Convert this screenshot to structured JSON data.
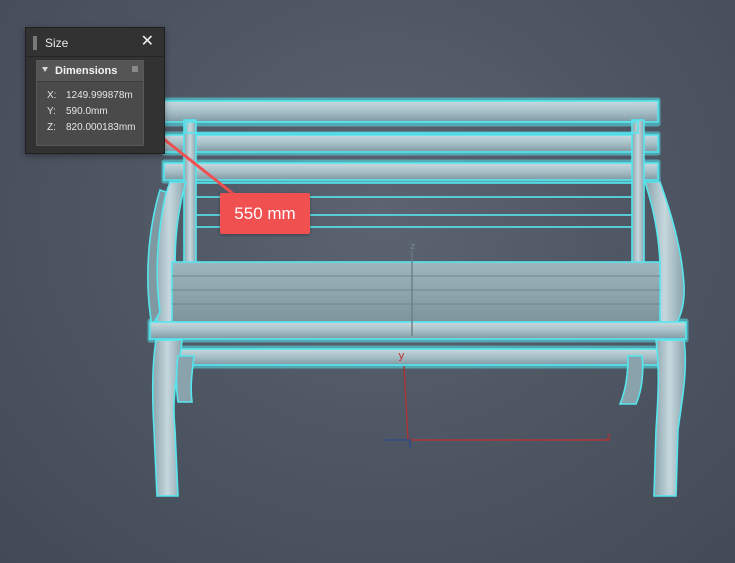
{
  "panel": {
    "title": "Size",
    "close_glyph": "✕",
    "section": {
      "label": "Dimensions",
      "x_label": "X:",
      "x_value": "1249.999878m",
      "y_label": "Y:",
      "y_value": "590.0mm",
      "z_label": "Z:",
      "z_value": "820.000183mm"
    }
  },
  "callout": {
    "text": "550 mm",
    "color": "#f05050"
  },
  "gizmo": {
    "x_axis_label": "z",
    "y_axis_label": "y",
    "z_axis_label": "z"
  },
  "colors": {
    "selection_outline": "#55e6ee",
    "bench_body": "#a9c1c9"
  },
  "icons": {
    "close": "close-icon",
    "collapse": "triangle-down-icon",
    "grip": "grip-icon"
  }
}
